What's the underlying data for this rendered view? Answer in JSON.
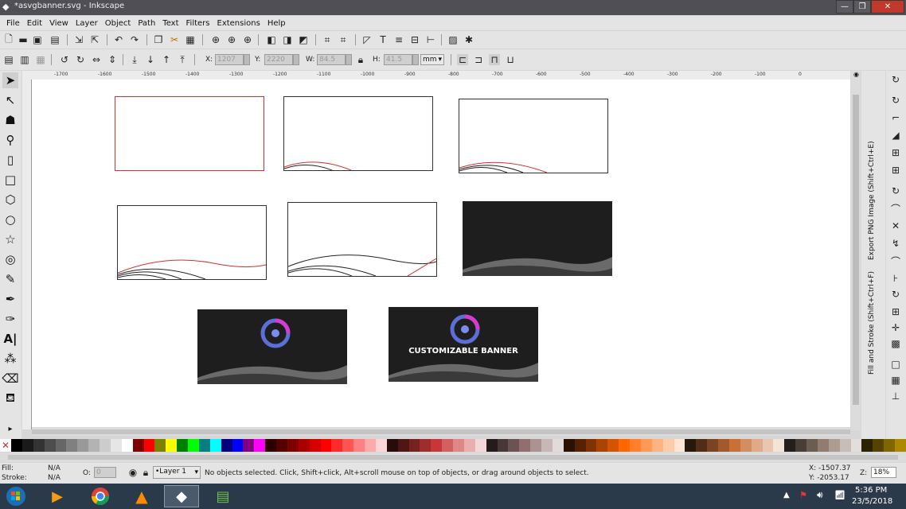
{
  "window": {
    "title": "*asvgbanner.svg - Inkscape",
    "minimize": "—",
    "maximize": "❐",
    "close": "✕"
  },
  "menu": [
    "File",
    "Edit",
    "View",
    "Layer",
    "Object",
    "Path",
    "Text",
    "Filters",
    "Extensions",
    "Help"
  ],
  "controls": {
    "x_label": "X:",
    "x_value": "1207",
    "y_label": "Y:",
    "y_value": "2220",
    "w_label": "W:",
    "w_value": "84.5",
    "h_label": "H:",
    "h_value": "41.5",
    "unit": "mm"
  },
  "ruler": {
    "labels": [
      "-1700",
      "-1600",
      "-1500",
      "-1400",
      "-1300",
      "-1200",
      "-1100",
      "-1000",
      "-900",
      "-800",
      "-700",
      "-600",
      "-500",
      "-400",
      "-300",
      "-200",
      "-100",
      "0"
    ]
  },
  "canvas": {
    "banner_text": "CUSTOMIZABLE BANNER",
    "colors": {
      "dark": "#1e1e1e",
      "wave": "#6a6a6a",
      "red": "#d32f2f"
    }
  },
  "dock": {
    "export_label": "Export PNG Image (Shift+Ctrl+E)",
    "fillstroke_label": "Fill and Stroke (Shift+Ctrl+F)"
  },
  "status": {
    "fill_label": "Fill:",
    "fill_value": "N/A",
    "stroke_label": "Stroke:",
    "stroke_value": "N/A",
    "opacity_label": "O:",
    "opacity_value": "0",
    "layer": "•Layer 1",
    "message": "No objects selected. Click, Shift+click, Alt+scroll mouse on top of objects, or drag around objects to select.",
    "x_coord": "X: -1507.37",
    "y_coord": "Y: -2053.17",
    "zoom_label": "Z:",
    "zoom": "18%"
  },
  "taskbar": {
    "time": "5:36 PM",
    "date": "23/5/2018"
  },
  "palette": [
    "#000000",
    "#1a1a1a",
    "#333333",
    "#4d4d4d",
    "#666666",
    "#808080",
    "#999999",
    "#b3b3b3",
    "#cccccc",
    "#e6e6e6",
    "#ffffff",
    "#800000",
    "#ff0000",
    "#808000",
    "#ffff00",
    "#008000",
    "#00ff00",
    "#008080",
    "#00ffff",
    "#000080",
    "#0000ff",
    "#800080",
    "#ff00ff",
    "#2b0000",
    "#550000",
    "#800000",
    "#aa0000",
    "#d40000",
    "#ff0000",
    "#ff2a2a",
    "#ff5555",
    "#ff8080",
    "#ffaaaa",
    "#ffd5d5",
    "#280b0b",
    "#501616",
    "#782121",
    "#a02c2c",
    "#c83737",
    "#d35f5f",
    "#de8787",
    "#e9afaf",
    "#f4d7d7",
    "#241c1c",
    "#483737",
    "#6c5353",
    "#916f6f",
    "#ac9393",
    "#c8b7b7",
    "#e3dbdb",
    "#2b1100",
    "#552200",
    "#803300",
    "#aa4400",
    "#d45500",
    "#ff6600",
    "#ff7f2a",
    "#ff9955",
    "#ffb380",
    "#ffccaa",
    "#ffe6d5",
    "#28170b",
    "#502d16",
    "#784421",
    "#a05a2c",
    "#c87137",
    "#d38d5f",
    "#deaa87",
    "#e9c6af",
    "#f4e3d7",
    "#241f1c",
    "#483e37",
    "#6c5d53",
    "#917c6f",
    "#ac9d93",
    "#c8beb7",
    "#e3dedb",
    "#2b2200",
    "#554400",
    "#806600",
    "#aa8800"
  ]
}
